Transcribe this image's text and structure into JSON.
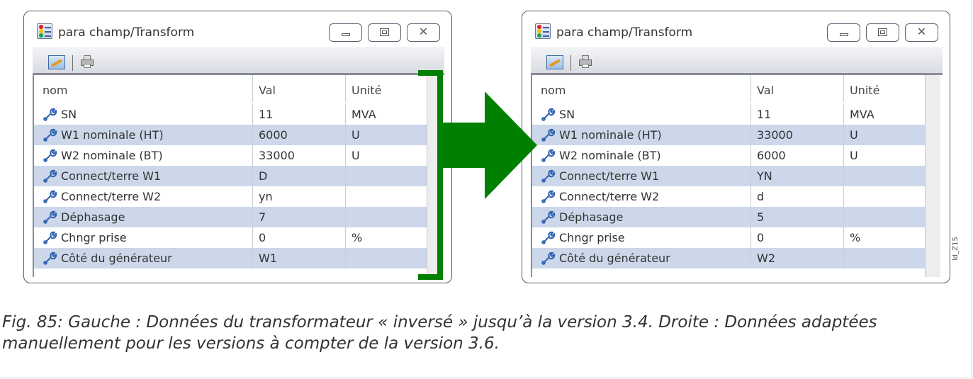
{
  "left_window": {
    "title": "para champ/Transform",
    "columns": [
      "nom",
      "Val",
      "Unité"
    ],
    "rows": [
      {
        "name": "SN",
        "val": "11",
        "unit": "MVA"
      },
      {
        "name": "W1 nominale (HT)",
        "val": "6000",
        "unit": "U"
      },
      {
        "name": "W2 nominale (BT)",
        "val": "33000",
        "unit": "U"
      },
      {
        "name": "Connect/terre W1",
        "val": "D",
        "unit": ""
      },
      {
        "name": "Connect/terre W2",
        "val": "yn",
        "unit": ""
      },
      {
        "name": "Déphasage",
        "val": "7",
        "unit": ""
      },
      {
        "name": "Chngr prise",
        "val": "0",
        "unit": "%"
      },
      {
        "name": "Côté du générateur",
        "val": "W1",
        "unit": ""
      }
    ],
    "minimize_symbol": "▭",
    "restore_symbol": "▣",
    "close_symbol": "✕"
  },
  "right_window": {
    "title": "para champ/Transform",
    "columns": [
      "nom",
      "Val",
      "Unité"
    ],
    "rows": [
      {
        "name": "SN",
        "val": "11",
        "unit": "MVA"
      },
      {
        "name": "W1 nominale (HT)",
        "val": "33000",
        "unit": "U"
      },
      {
        "name": "W2 nominale (BT)",
        "val": "6000",
        "unit": "U"
      },
      {
        "name": "Connect/terre W1",
        "val": "YN",
        "unit": ""
      },
      {
        "name": "Connect/terre W2",
        "val": "d",
        "unit": ""
      },
      {
        "name": "Déphasage",
        "val": "5",
        "unit": ""
      },
      {
        "name": "Chngr prise",
        "val": "0",
        "unit": "%"
      },
      {
        "name": "Côté du générateur",
        "val": "W2",
        "unit": ""
      }
    ],
    "minimize_symbol": "▭",
    "restore_symbol": "▣",
    "close_symbol": "✕"
  },
  "side_label": "ld_Z15",
  "caption": "Fig. 85: Gauche : Données du transformateur « inversé » jusqu’à la version 3.4. Droite : Données adaptées manuellement pour les versions à compter de la version 3.6.",
  "colors": {
    "arrow": "#008000",
    "row_alt": "#ccd8ea",
    "window_border": "#4f5a68"
  },
  "icons": {
    "app": "traffic-light-table-icon",
    "edit": "edit-parameters-icon",
    "print": "printer-icon",
    "row": "wrench-icon"
  }
}
